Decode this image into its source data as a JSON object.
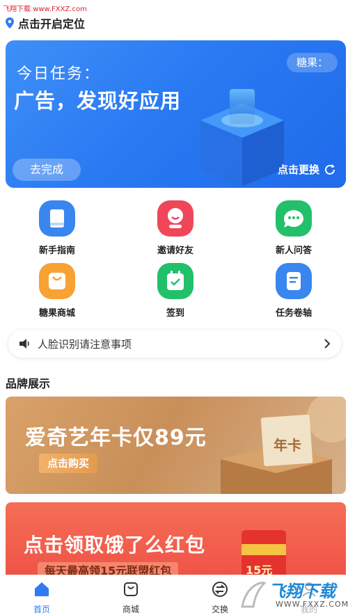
{
  "watermark_top": "飞翔下载 www.FXXZ.com",
  "location": {
    "label": "点击开启定位"
  },
  "task_banner": {
    "title": "今日任务：",
    "task": "广告，发现好应用",
    "candy_label": "糖果：",
    "go_button": "去完成",
    "refresh_label": "点击更换"
  },
  "features": [
    {
      "label": "新手指南",
      "icon": "book-icon",
      "color": "#3a86f0"
    },
    {
      "label": "邀请好友",
      "icon": "smile-face-icon",
      "color": "#f0465a"
    },
    {
      "label": "新人问答",
      "icon": "chat-bubble-icon",
      "color": "#22c06a"
    },
    {
      "label": "糖果商城",
      "icon": "shopping-bag-icon",
      "color": "#f7a233"
    },
    {
      "label": "签到",
      "icon": "calendar-check-icon",
      "color": "#22c06a"
    },
    {
      "label": "任务卷轴",
      "icon": "scroll-icon",
      "color": "#3a86f0"
    }
  ],
  "notice": {
    "text": "人脸识别请注意事项"
  },
  "brand_section": {
    "title": "品牌展示"
  },
  "promo_iqiyi": {
    "headline": "爱奇艺年卡仅89元",
    "button": "点击购买",
    "card_label": "年卡"
  },
  "promo_eleme": {
    "headline": "点击领取饿了么红包",
    "sub": "每天最高领15元联盟红包",
    "amount": "15元"
  },
  "tabs": [
    {
      "label": "首页",
      "icon": "home-icon",
      "active": true
    },
    {
      "label": "商城",
      "icon": "bag-icon",
      "active": false
    },
    {
      "label": "交换",
      "icon": "exchange-icon",
      "active": false
    },
    {
      "label": "我的",
      "icon": "user-icon",
      "active": false
    }
  ],
  "watermark_bottom": {
    "brand": "飞翔下载",
    "url": "WWW.FXXZ.COM"
  },
  "colors": {
    "accent": "#2f7bf3",
    "banner_blue": "#2a7af3",
    "iqiyi_gold": "#c98f59",
    "eleme_red": "#ee4b43"
  }
}
